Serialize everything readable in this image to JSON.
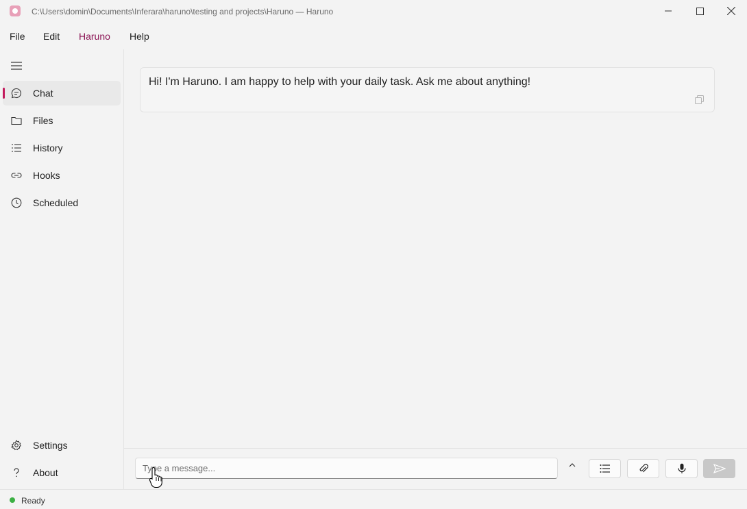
{
  "window": {
    "title": "C:\\Users\\domin\\Documents\\Inferara\\haruno\\testing and projects\\Haruno — Haruno"
  },
  "menu": {
    "items": [
      {
        "label": "File"
      },
      {
        "label": "Edit"
      },
      {
        "label": "Haruno",
        "active": true
      },
      {
        "label": "Help"
      }
    ]
  },
  "sidebar": {
    "items": [
      {
        "label": "Chat",
        "icon": "chat-bubble-icon",
        "selected": true
      },
      {
        "label": "Files",
        "icon": "folder-icon"
      },
      {
        "label": "History",
        "icon": "list-icon"
      },
      {
        "label": "Hooks",
        "icon": "link-icon"
      },
      {
        "label": "Scheduled",
        "icon": "clock-icon"
      }
    ],
    "footer": [
      {
        "label": "Settings",
        "icon": "gear-icon"
      },
      {
        "label": "About",
        "icon": "question-icon"
      }
    ]
  },
  "chat": {
    "messages": [
      {
        "text": "Hi! I'm Haruno. I am happy to help with your daily task. Ask me about anything!"
      }
    ]
  },
  "composer": {
    "placeholder": "Type a message...",
    "value": ""
  },
  "status": {
    "text": "Ready"
  },
  "colors": {
    "accent": "#c2185b",
    "menu_active": "#8b1454",
    "status_ok": "#3cb043"
  }
}
